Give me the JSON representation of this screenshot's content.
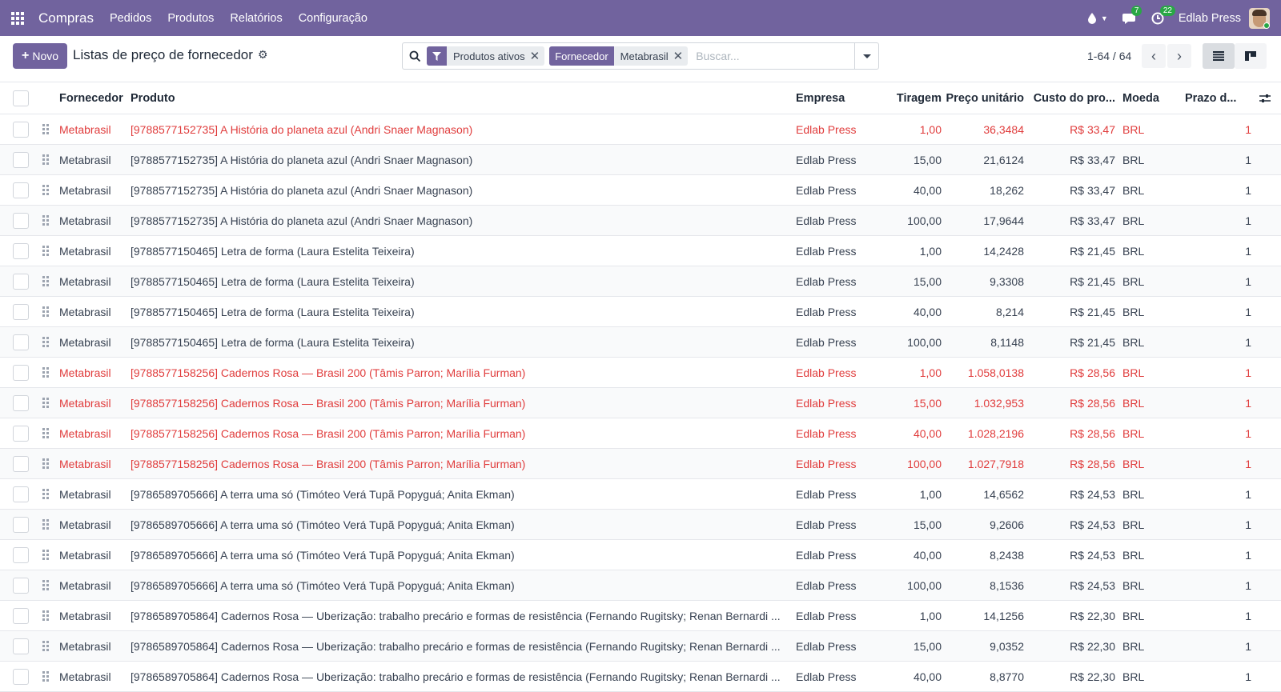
{
  "navbar": {
    "app_name": "Compras",
    "menu": [
      "Pedidos",
      "Produtos",
      "Relatórios",
      "Configuração"
    ],
    "messages_count": "7",
    "activities_count": "22",
    "user": "Edlab Press"
  },
  "control": {
    "new_label": "Novo",
    "title": "Listas de preço de fornecedor",
    "filter_facet": "Produtos ativos",
    "group_facet_label": "Fornecedor",
    "group_facet_value": "Metabrasil",
    "search_placeholder": "Buscar...",
    "pager": "1-64 / 64"
  },
  "table": {
    "headers": {
      "fornecedor": "Fornecedor",
      "produto": "Produto",
      "empresa": "Empresa",
      "tiragem": "Tiragem",
      "preco": "Preço unitário",
      "custo": "Custo do pro...",
      "moeda": "Moeda",
      "prazo": "Prazo d..."
    },
    "rows": [
      {
        "fornecedor": "Metabrasil",
        "produto": "[9788577152735] A História do planeta azul (Andri Snaer Magnason)",
        "empresa": "Edlab Press",
        "tiragem": "1,00",
        "preco": "36,3484",
        "custo": "R$ 33,47",
        "moeda": "BRL",
        "prazo": "1",
        "red": true
      },
      {
        "fornecedor": "Metabrasil",
        "produto": "[9788577152735] A História do planeta azul (Andri Snaer Magnason)",
        "empresa": "Edlab Press",
        "tiragem": "15,00",
        "preco": "21,6124",
        "custo": "R$ 33,47",
        "moeda": "BRL",
        "prazo": "1",
        "red": false
      },
      {
        "fornecedor": "Metabrasil",
        "produto": "[9788577152735] A História do planeta azul (Andri Snaer Magnason)",
        "empresa": "Edlab Press",
        "tiragem": "40,00",
        "preco": "18,262",
        "custo": "R$ 33,47",
        "moeda": "BRL",
        "prazo": "1",
        "red": false
      },
      {
        "fornecedor": "Metabrasil",
        "produto": "[9788577152735] A História do planeta azul (Andri Snaer Magnason)",
        "empresa": "Edlab Press",
        "tiragem": "100,00",
        "preco": "17,9644",
        "custo": "R$ 33,47",
        "moeda": "BRL",
        "prazo": "1",
        "red": false
      },
      {
        "fornecedor": "Metabrasil",
        "produto": "[9788577150465] Letra de forma (Laura Estelita Teixeira)",
        "empresa": "Edlab Press",
        "tiragem": "1,00",
        "preco": "14,2428",
        "custo": "R$ 21,45",
        "moeda": "BRL",
        "prazo": "1",
        "red": false
      },
      {
        "fornecedor": "Metabrasil",
        "produto": "[9788577150465] Letra de forma (Laura Estelita Teixeira)",
        "empresa": "Edlab Press",
        "tiragem": "15,00",
        "preco": "9,3308",
        "custo": "R$ 21,45",
        "moeda": "BRL",
        "prazo": "1",
        "red": false
      },
      {
        "fornecedor": "Metabrasil",
        "produto": "[9788577150465] Letra de forma (Laura Estelita Teixeira)",
        "empresa": "Edlab Press",
        "tiragem": "40,00",
        "preco": "8,214",
        "custo": "R$ 21,45",
        "moeda": "BRL",
        "prazo": "1",
        "red": false
      },
      {
        "fornecedor": "Metabrasil",
        "produto": "[9788577150465] Letra de forma (Laura Estelita Teixeira)",
        "empresa": "Edlab Press",
        "tiragem": "100,00",
        "preco": "8,1148",
        "custo": "R$ 21,45",
        "moeda": "BRL",
        "prazo": "1",
        "red": false
      },
      {
        "fornecedor": "Metabrasil",
        "produto": "[9788577158256] Cadernos Rosa — Brasil 200 (Tâmis Parron; Marília Furman)",
        "empresa": "Edlab Press",
        "tiragem": "1,00",
        "preco": "1.058,0138",
        "custo": "R$ 28,56",
        "moeda": "BRL",
        "prazo": "1",
        "red": true
      },
      {
        "fornecedor": "Metabrasil",
        "produto": "[9788577158256] Cadernos Rosa — Brasil 200 (Tâmis Parron; Marília Furman)",
        "empresa": "Edlab Press",
        "tiragem": "15,00",
        "preco": "1.032,953",
        "custo": "R$ 28,56",
        "moeda": "BRL",
        "prazo": "1",
        "red": true
      },
      {
        "fornecedor": "Metabrasil",
        "produto": "[9788577158256] Cadernos Rosa — Brasil 200 (Tâmis Parron; Marília Furman)",
        "empresa": "Edlab Press",
        "tiragem": "40,00",
        "preco": "1.028,2196",
        "custo": "R$ 28,56",
        "moeda": "BRL",
        "prazo": "1",
        "red": true
      },
      {
        "fornecedor": "Metabrasil",
        "produto": "[9788577158256] Cadernos Rosa — Brasil 200 (Tâmis Parron; Marília Furman)",
        "empresa": "Edlab Press",
        "tiragem": "100,00",
        "preco": "1.027,7918",
        "custo": "R$ 28,56",
        "moeda": "BRL",
        "prazo": "1",
        "red": true
      },
      {
        "fornecedor": "Metabrasil",
        "produto": "[9786589705666] A terra uma só (Timóteo Verá Tupã Popyguá; Anita Ekman)",
        "empresa": "Edlab Press",
        "tiragem": "1,00",
        "preco": "14,6562",
        "custo": "R$ 24,53",
        "moeda": "BRL",
        "prazo": "1",
        "red": false
      },
      {
        "fornecedor": "Metabrasil",
        "produto": "[9786589705666] A terra uma só (Timóteo Verá Tupã Popyguá; Anita Ekman)",
        "empresa": "Edlab Press",
        "tiragem": "15,00",
        "preco": "9,2606",
        "custo": "R$ 24,53",
        "moeda": "BRL",
        "prazo": "1",
        "red": false
      },
      {
        "fornecedor": "Metabrasil",
        "produto": "[9786589705666] A terra uma só (Timóteo Verá Tupã Popyguá; Anita Ekman)",
        "empresa": "Edlab Press",
        "tiragem": "40,00",
        "preco": "8,2438",
        "custo": "R$ 24,53",
        "moeda": "BRL",
        "prazo": "1",
        "red": false
      },
      {
        "fornecedor": "Metabrasil",
        "produto": "[9786589705666] A terra uma só (Timóteo Verá Tupã Popyguá; Anita Ekman)",
        "empresa": "Edlab Press",
        "tiragem": "100,00",
        "preco": "8,1536",
        "custo": "R$ 24,53",
        "moeda": "BRL",
        "prazo": "1",
        "red": false
      },
      {
        "fornecedor": "Metabrasil",
        "produto": "[9786589705864] Cadernos Rosa — Uberização: trabalho precário e formas de resistência (Fernando Rugitsky; Renan Bernardi ...",
        "empresa": "Edlab Press",
        "tiragem": "1,00",
        "preco": "14,1256",
        "custo": "R$ 22,30",
        "moeda": "BRL",
        "prazo": "1",
        "red": false
      },
      {
        "fornecedor": "Metabrasil",
        "produto": "[9786589705864] Cadernos Rosa — Uberização: trabalho precário e formas de resistência (Fernando Rugitsky; Renan Bernardi ...",
        "empresa": "Edlab Press",
        "tiragem": "15,00",
        "preco": "9,0352",
        "custo": "R$ 22,30",
        "moeda": "BRL",
        "prazo": "1",
        "red": false
      },
      {
        "fornecedor": "Metabrasil",
        "produto": "[9786589705864] Cadernos Rosa — Uberização: trabalho precário e formas de resistência (Fernando Rugitsky; Renan Bernardi ...",
        "empresa": "Edlab Press",
        "tiragem": "40,00",
        "preco": "8,8770",
        "custo": "R$ 22,30",
        "moeda": "BRL",
        "prazo": "1",
        "red": false
      }
    ]
  }
}
